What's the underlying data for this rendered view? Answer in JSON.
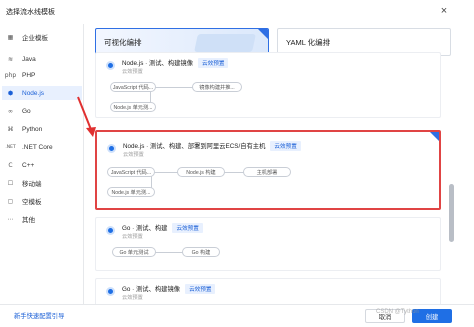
{
  "dialog": {
    "title": "选择流水线模板",
    "close": "×"
  },
  "sidebar": {
    "items": [
      {
        "icon": "▦",
        "label": "企业模板"
      },
      {
        "icon": "≋",
        "label": "Java"
      },
      {
        "icon": "php",
        "label": "PHP"
      },
      {
        "icon": "⬢",
        "label": "Node.js"
      },
      {
        "icon": "∞",
        "label": "Go"
      },
      {
        "icon": "⌘",
        "label": "Python"
      },
      {
        "icon": ".NET",
        "label": ".NET Core"
      },
      {
        "icon": "C",
        "label": "C++"
      },
      {
        "icon": "☐",
        "label": "移动端"
      },
      {
        "icon": "▢",
        "label": "空模板"
      },
      {
        "icon": "⋯",
        "label": "其他"
      }
    ]
  },
  "tabs": {
    "visual": "可视化编排",
    "yaml": "YAML 化编排"
  },
  "cards": [
    {
      "name": "Node.js · 测试、构建镜像",
      "tag": "云效预置",
      "sub": "云效预置",
      "nodes": [
        "JavaScript 代码...",
        "Node.js 单元测...",
        "镜像构建并推..."
      ]
    },
    {
      "name": "Node.js · 测试、构建、部署到阿里云ECS/自有主机",
      "tag": "云效预置",
      "sub": "云效预置",
      "nodes": [
        "JavaScript 代码...",
        "Node.js 单元测...",
        "Node.js 构建",
        "主机部署"
      ]
    },
    {
      "name": "Go · 测试、构建",
      "tag": "云效预置",
      "sub": "云效预置",
      "nodes": [
        "Go 单元测试",
        "Go 构建"
      ]
    },
    {
      "name": "Go · 测试、构建镜像",
      "tag": "云效预置",
      "sub": "云效预置",
      "nodes": []
    }
  ],
  "footer": {
    "guide": "新手快速配置引导",
    "cancel": "取消",
    "create": "创建",
    "watermark": "CSDN @Tython"
  },
  "colors": {
    "accent": "#1f6fe5",
    "highlight": "#e04444",
    "arrow": "#e03030"
  }
}
